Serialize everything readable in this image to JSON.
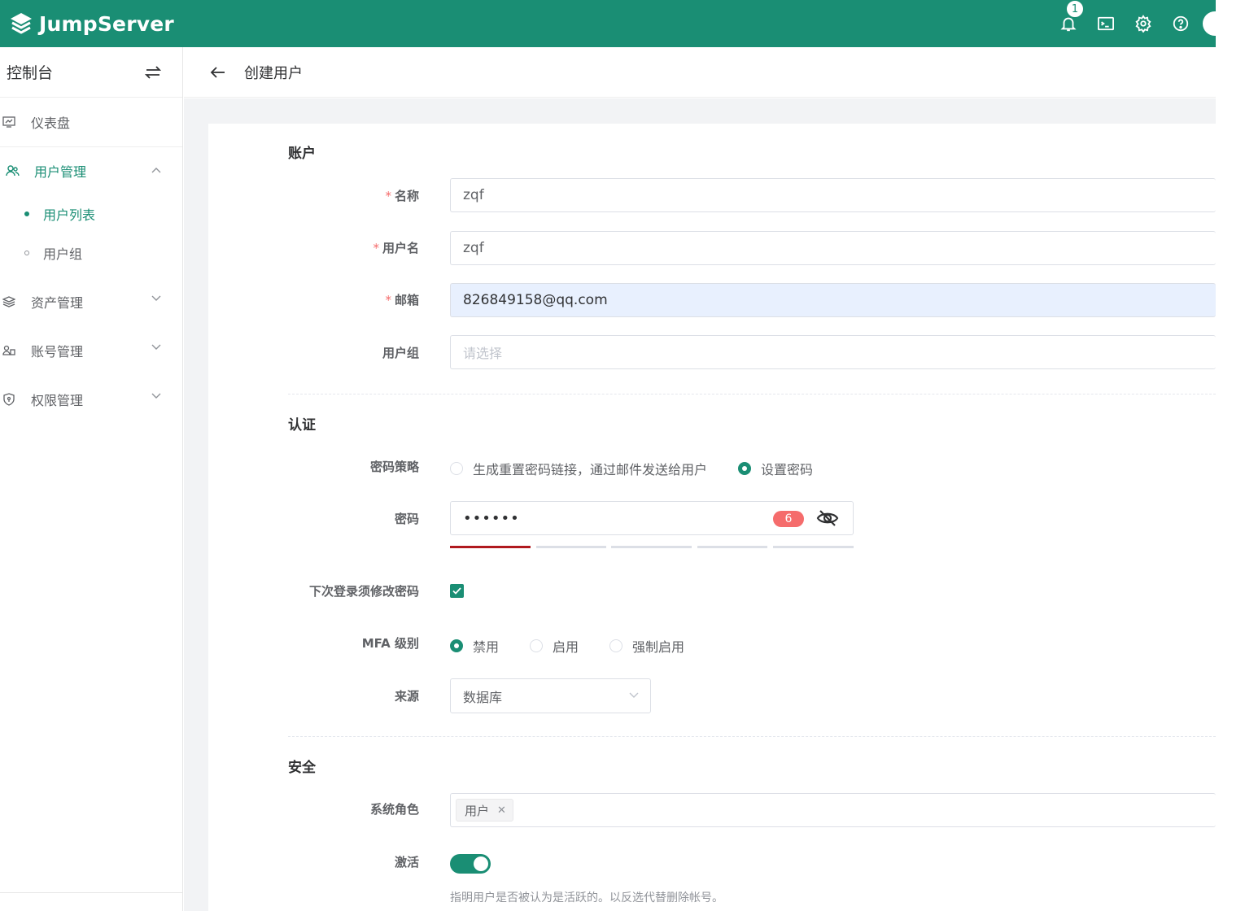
{
  "app": {
    "brand": "JumpServer"
  },
  "colors": {
    "primary": "#1a8e74",
    "danger": "#f56c6c",
    "strength_weak": "#b0191e"
  },
  "header": {
    "icons": [
      "bell-icon",
      "terminal-icon",
      "gear-icon",
      "help-icon"
    ],
    "notification_count": "1"
  },
  "sidebar": {
    "title": "控制台",
    "items": [
      {
        "label": "仪表盘",
        "icon": "dashboard-icon"
      },
      {
        "label": "用户管理",
        "icon": "users-icon",
        "expanded": true,
        "children": [
          {
            "label": "用户列表",
            "active": true
          },
          {
            "label": "用户组"
          }
        ]
      },
      {
        "label": "资产管理",
        "icon": "assets-icon"
      },
      {
        "label": "账号管理",
        "icon": "accounts-icon"
      },
      {
        "label": "权限管理",
        "icon": "permission-icon"
      }
    ]
  },
  "page": {
    "title": "创建用户"
  },
  "form": {
    "sections": {
      "account": "账户",
      "auth": "认证",
      "security": "安全"
    },
    "name": {
      "label": "名称",
      "value": "zqf"
    },
    "username": {
      "label": "用户名",
      "value": "zqf"
    },
    "email": {
      "label": "邮箱",
      "value": "826849158@qq.com"
    },
    "groups": {
      "label": "用户组",
      "placeholder": "请选择"
    },
    "password_strategy": {
      "label": "密码策略",
      "options": [
        "生成重置密码链接，通过邮件发送给用户",
        "设置密码"
      ],
      "selected": 1
    },
    "password": {
      "label": "密码",
      "masked": "••••••",
      "length": "6",
      "strength_level": 1,
      "strength_max": 5
    },
    "need_update_password": {
      "label": "下次登录须修改密码",
      "checked": true
    },
    "mfa_level": {
      "label": "MFA 级别",
      "options": [
        "禁用",
        "启用",
        "强制启用"
      ],
      "selected": 0
    },
    "source": {
      "label": "来源",
      "value": "数据库"
    },
    "system_roles": {
      "label": "系统角色",
      "tags": [
        "用户"
      ]
    },
    "is_active": {
      "label": "激活",
      "on": true,
      "hint": "指明用户是否被认为是活跃的。以反选代替删除帐号。"
    }
  }
}
